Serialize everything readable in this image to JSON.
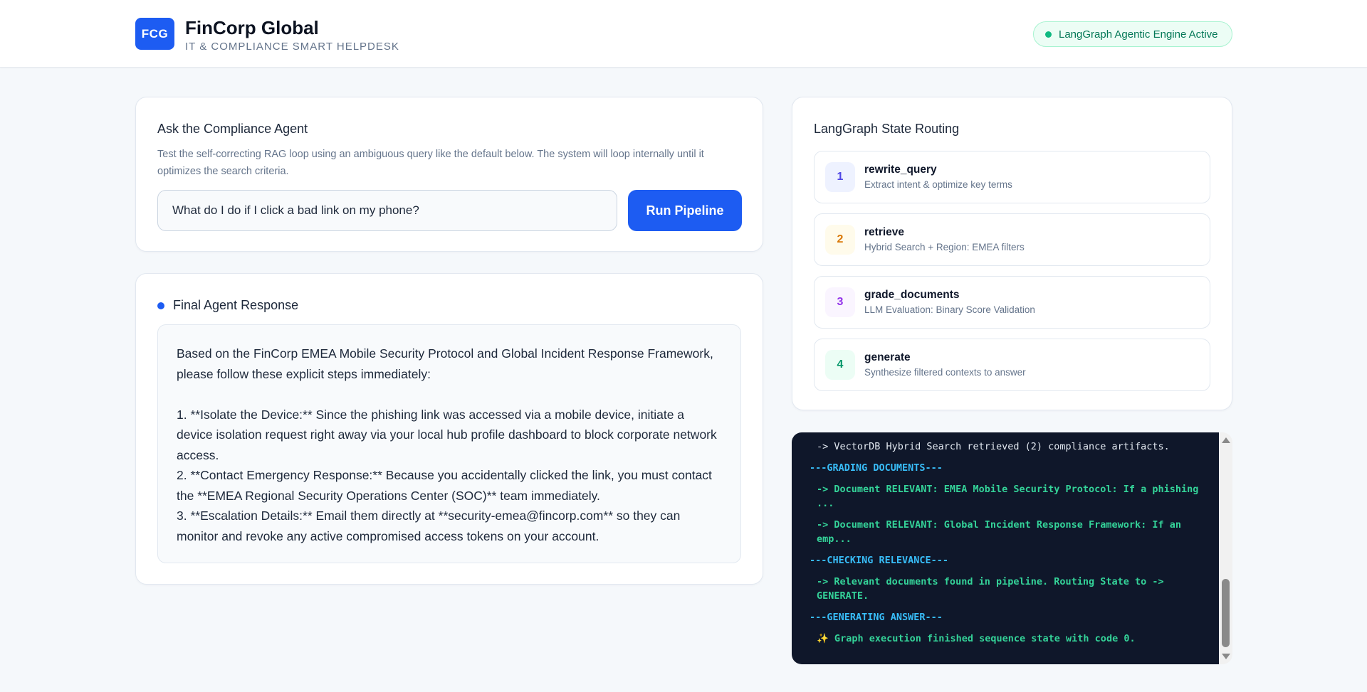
{
  "header": {
    "logo_text": "FCG",
    "title": "FinCorp Global",
    "subtitle": "IT & COMPLIANCE SMART HELPDESK",
    "status_text": "LangGraph Agentic Engine Active"
  },
  "ask": {
    "title": "Ask the Compliance Agent",
    "description": "Test the self-correcting RAG loop using an ambiguous query like the default below. The system will loop internally until it optimizes the search criteria.",
    "query_value": "What do I do if I click a bad link on my phone?",
    "run_label": "Run Pipeline"
  },
  "response": {
    "title": "Final Agent Response",
    "intro": "Based on the FinCorp EMEA Mobile Security Protocol and Global Incident Response Framework, please follow these explicit steps immediately:",
    "steps": [
      "1. **Isolate the Device:** Since the phishing link was accessed via a mobile device, initiate a device isolation request right away via your local hub profile dashboard to block corporate network access.",
      "2. **Contact Emergency Response:** Because you accidentally clicked the link, you must contact the **EMEA Regional Security Operations Center (SOC)** team immediately.",
      "3. **Escalation Details:** Email them directly at **security-emea@fincorp.com** so they can monitor and revoke any active compromised access tokens on your account."
    ]
  },
  "routing": {
    "title": "LangGraph State Routing",
    "steps": [
      {
        "num": "1",
        "name": "rewrite_query",
        "desc": "Extract intent & optimize key terms"
      },
      {
        "num": "2",
        "name": "retrieve",
        "desc": "Hybrid Search + Region: EMEA filters"
      },
      {
        "num": "3",
        "name": "grade_documents",
        "desc": "LLM Evaluation: Binary Score Validation"
      },
      {
        "num": "4",
        "name": "generate",
        "desc": "Synthesize filtered contexts to answer"
      }
    ]
  },
  "colors": {
    "accent": "#1d5cf2",
    "step1_fg": "#4f46e5",
    "step1_bg": "#eef2ff",
    "step2_fg": "#d97706",
    "step2_bg": "#fffbeb",
    "step3_fg": "#9333ea",
    "step3_bg": "#faf5ff",
    "step4_fg": "#059669",
    "step4_bg": "#ecfdf5"
  },
  "logs": [
    "-> VectorDB Hybrid Search retrieved (2) compliance artifacts.",
    "---GRADING DOCUMENTS---",
    "-> Document RELEVANT: EMEA Mobile Security Protocol: If a phishing ...",
    "-> Document RELEVANT: Global Incident Response Framework: If an emp...",
    "---CHECKING RELEVANCE---",
    "-> Relevant documents found in pipeline. Routing State to -> GENERATE.",
    "---GENERATING ANSWER---",
    "✨ Graph execution finished sequence state with code 0."
  ]
}
